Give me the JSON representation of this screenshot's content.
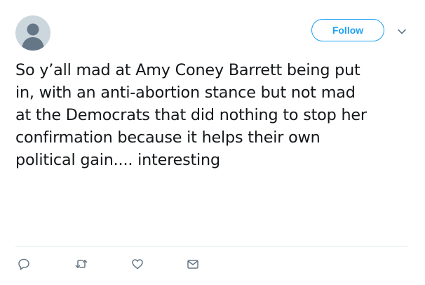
{
  "follow_button": {
    "label": "Follow"
  },
  "tweet": {
    "lines": [
      "So y’all mad at Amy Coney Barrett being put",
      "in, with an anti-abortion stance but not mad",
      "at the Democrats that did nothing to stop her",
      "confirmation because it helps their own",
      "political gain.... interesting"
    ]
  },
  "icons": {
    "avatar": "default-profile-icon",
    "caret": "chevron-down-icon",
    "reply": "reply-icon",
    "retweet": "retweet-icon",
    "like": "heart-icon",
    "message": "envelope-icon"
  },
  "colors": {
    "accent": "#1da1f2",
    "text": "#14171a",
    "icon": "#657786",
    "avatar_bg": "#ccd6dd",
    "avatar_fg": "#657786",
    "divider": "#e6ecf0"
  }
}
